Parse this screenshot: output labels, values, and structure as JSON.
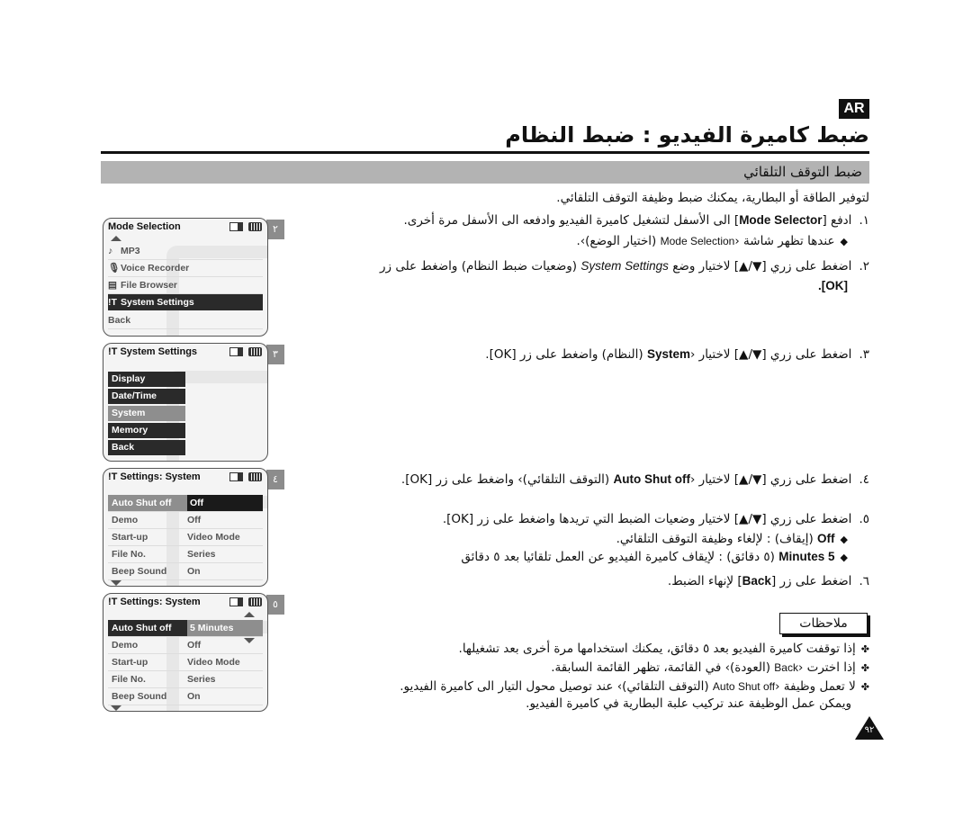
{
  "header": {
    "lang_badge": "AR",
    "title": "ضبط كاميرة الفيديو : ضبط النظام",
    "section": "ضبط التوقف التلقائي"
  },
  "intro": "لتوفير الطاقة أو البطارية، يمكنك ضبط وظيفة التوقف التلقائي.",
  "steps": [
    {
      "num": "١.",
      "pre": "ادفع [",
      "bold": "Mode Selector",
      "post": "] الى الأسفل لتشغيل كاميرة الفيديو وادفعه الى الأسفل مرة أخرى.",
      "sub": {
        "pre": "عندها تظهر شاشة ‹",
        "en": "Mode Selection",
        "post": " (اختيار الوضع)›."
      }
    },
    {
      "num": "٢.",
      "pre": "اضغط على زري [▼/▲] لاختيار وضع ",
      "italic": "System Settings",
      "post": " (وضعيات ضبط النظام) واضغط على زر",
      "line2": "[OK]."
    },
    {
      "num": "٣.",
      "pre": "اضغط على زري [▼/▲] لاختيار ‹",
      "bold": "System",
      "post": " (النظام) واضغط على زر [OK]."
    },
    {
      "num": "٤.",
      "pre": "اضغط على زري [▼/▲] لاختيار ‹",
      "bold": "Auto Shut off",
      "post": " (التوقف التلقائي)› واضغط على زر [OK]."
    },
    {
      "num": "٥.",
      "text": "اضغط على زري [▼/▲] لاختيار وضعيات الضبط التي تريدها واضغط على زر [OK].",
      "options": [
        {
          "bold": "Off",
          "text": " (إيقاف) : لإلغاء وظيفة التوقف التلقائي."
        },
        {
          "bold": "5 Minutes",
          "text": " (٥ دقائق) : لإيقاف كاميرة الفيديو عن العمل تلقائيا بعد ٥ دقائق"
        }
      ]
    },
    {
      "num": "٦.",
      "pre": "اضغط على زر [",
      "bold": "Back",
      "post": "] لإنهاء الضبط."
    }
  ],
  "notes": {
    "title": "ملاحظات",
    "items": [
      "إذا توقفت كاميرة الفيديو بعد ٥ دقائق، يمكنك استخدامها مرة أخرى بعد تشغيلها.",
      {
        "pre": "إذا اخترت ‹",
        "en": "Back",
        "post": " (العودة)› في القائمة، تظهر القائمة السابقة."
      },
      {
        "pre": "لا تعمل وظيفة ‹",
        "en": "Auto Shut off",
        "post": " (التوقف التلقائي)› عند توصيل محول التيار الى كاميرة الفيديو.",
        "line2": "ويمكن عمل الوظيفة عند تركيب علبة البطارية في كاميرة الفيديو."
      }
    ]
  },
  "screens": [
    {
      "step": "٢",
      "title": "Mode Selection",
      "items": [
        {
          "icon": "♪",
          "label": "MP3"
        },
        {
          "icon": "🎙",
          "label": "Voice Recorder"
        },
        {
          "icon": "▤",
          "label": "File Browser"
        },
        {
          "icon": "ǃT",
          "label": "System Settings",
          "selected": true
        },
        {
          "icon": "",
          "label": "Back"
        }
      ]
    },
    {
      "step": "٣",
      "title": "System Settings",
      "items": [
        "Display",
        "Date/Time",
        "System",
        "Memory",
        "Back"
      ],
      "highlighted": "System"
    },
    {
      "step": "٤",
      "title": "Settings: System",
      "rows": [
        {
          "label": "Auto Shut off",
          "value": "Off"
        },
        {
          "label": "Demo",
          "value": "Off"
        },
        {
          "label": "Start-up",
          "value": "Video Mode"
        },
        {
          "label": "File No.",
          "value": "Series"
        },
        {
          "label": "Beep Sound",
          "value": "On"
        }
      ]
    },
    {
      "step": "٥",
      "title": "Settings: System",
      "rows": [
        {
          "label": "Auto Shut off",
          "value": "5 Minutes"
        },
        {
          "label": "Demo",
          "value": "Off"
        },
        {
          "label": "Start-up",
          "value": "Video Mode"
        },
        {
          "label": "File No.",
          "value": "Series"
        },
        {
          "label": "Beep Sound",
          "value": "On"
        }
      ]
    }
  ],
  "footer": {
    "page_number": "٩٢"
  }
}
